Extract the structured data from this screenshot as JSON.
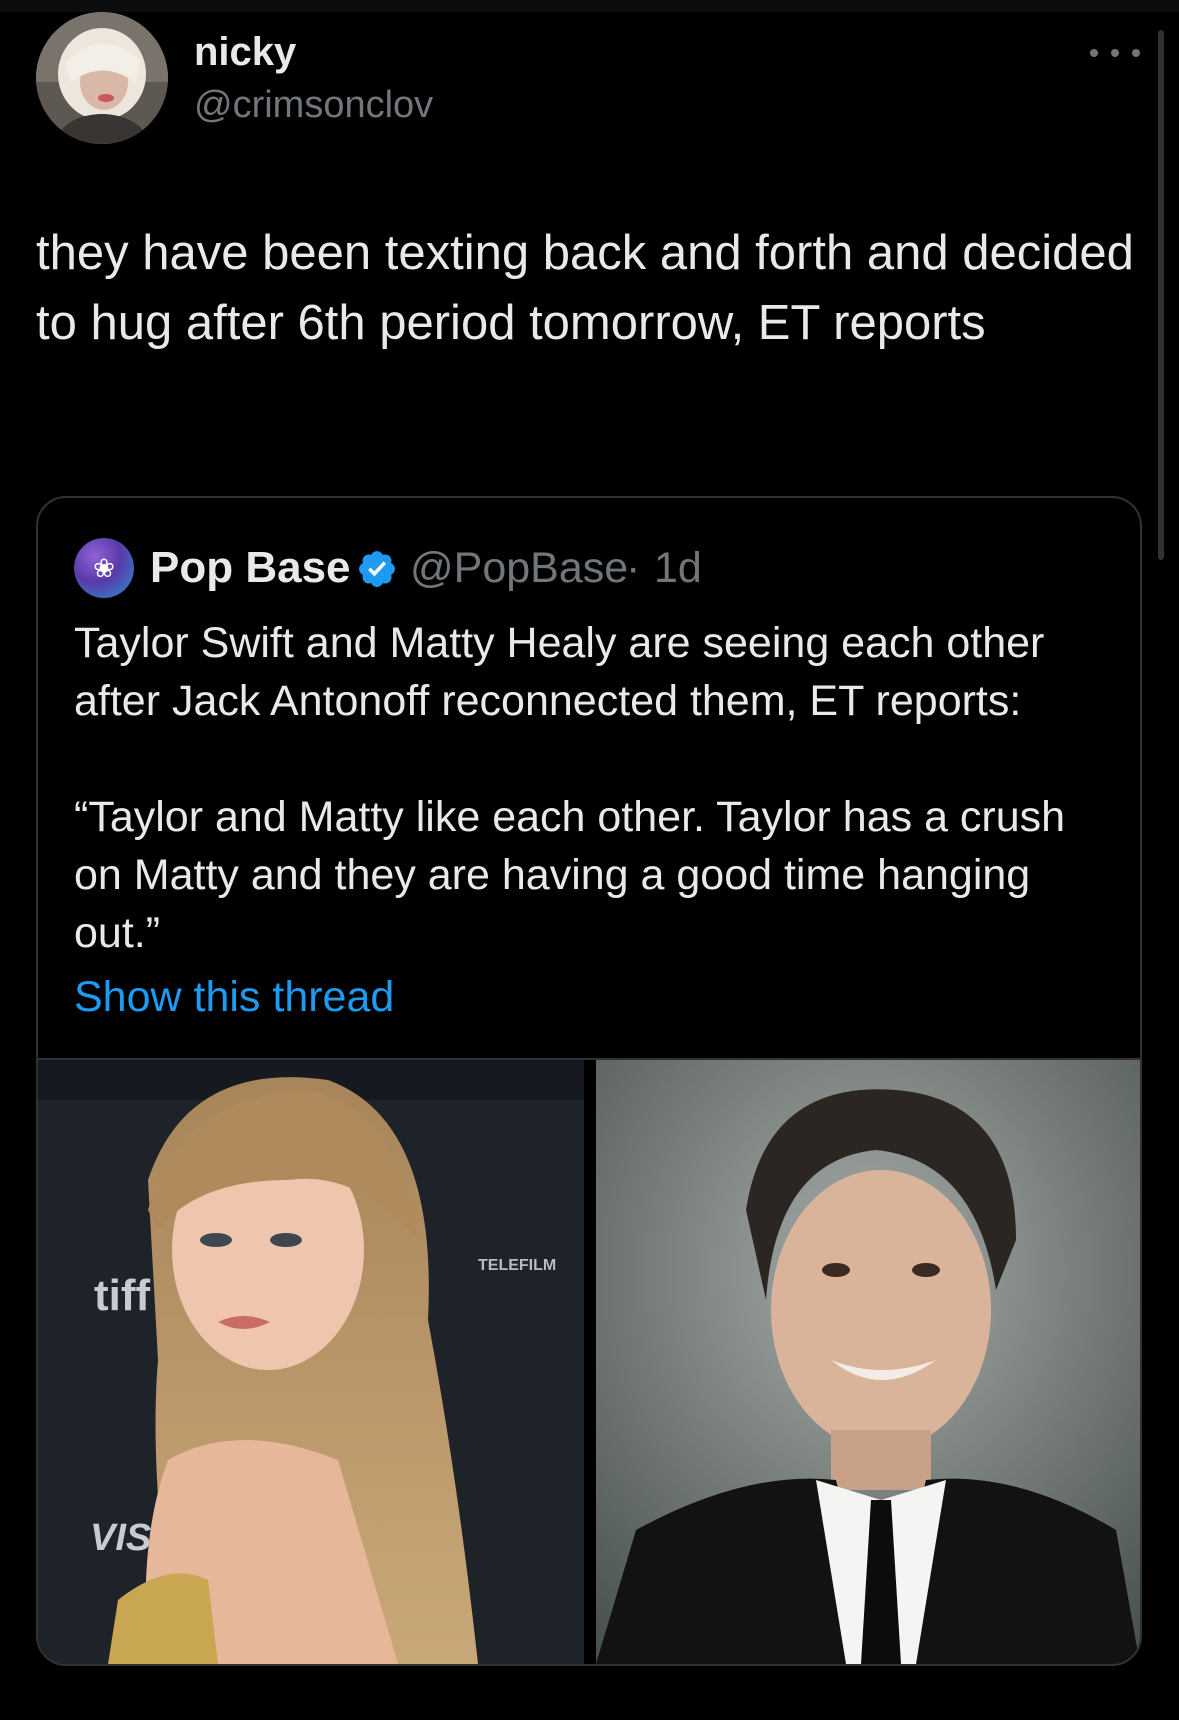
{
  "tweet": {
    "author_name": "nicky",
    "author_handle": "@crimsonclov",
    "text": "they have been texting back and forth and decided to hug after 6th period tomorrow, ET reports"
  },
  "menu_icon": "more-horizontal-icon",
  "quoted_tweet": {
    "author_name": "Pop Base",
    "verified": true,
    "author_handle": "@PopBase",
    "separator": "·",
    "time": "1d",
    "text": "Taylor Swift and Matty Healy are seeing each other after Jack Antonoff reconnected them, ET reports:",
    "quote": "“Taylor and Matty like each other. Taylor has a crush on Matty and they are having a good time hanging out.”",
    "show_thread_label": "Show this thread",
    "images": [
      {
        "name": "photo-left",
        "backdrop_text": [
          "tiff",
          "VISA",
          "TELEFILM"
        ]
      },
      {
        "name": "photo-right"
      }
    ]
  },
  "colors": {
    "background": "#000000",
    "text_primary": "#e7e9ea",
    "text_secondary": "#71767b",
    "link": "#1d9bf0",
    "border": "#2f3336",
    "verified": "#1d9bf0"
  }
}
